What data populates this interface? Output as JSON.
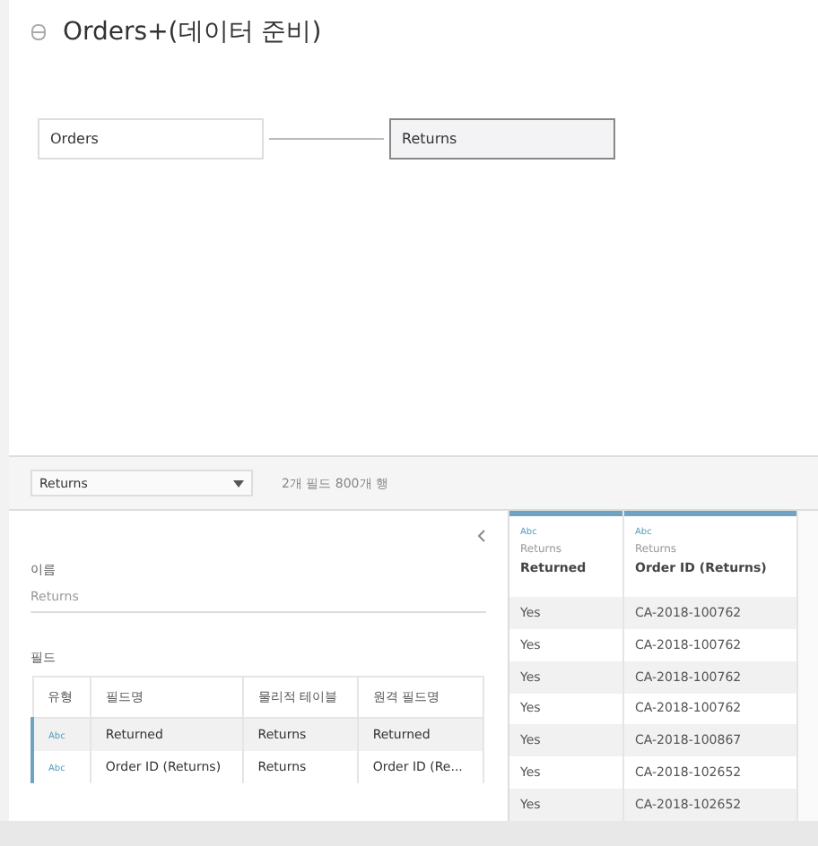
{
  "flow": {
    "title": "Orders+(데이터 준비)",
    "nodes": [
      {
        "label": "Orders",
        "selected": false
      },
      {
        "label": "Returns",
        "selected": true
      }
    ]
  },
  "toolbar": {
    "table_select": "Returns",
    "summary": "2개 필드 800개 행"
  },
  "details": {
    "name_label": "이름",
    "name_value": "Returns",
    "fields_label": "필드",
    "columns": [
      "유형",
      "필드명",
      "물리적 테이블",
      "원격 필드명"
    ],
    "rows": [
      {
        "type": "Abc",
        "field": "Returned",
        "table": "Returns",
        "remote": "Returned",
        "selected": true
      },
      {
        "type": "Abc",
        "field": "Order ID (Returns)",
        "table": "Returns",
        "remote": "Order ID (Re...",
        "selected": false
      }
    ]
  },
  "grid": {
    "columns": [
      {
        "type": "Abc",
        "source": "Returns",
        "name": "Returned"
      },
      {
        "type": "Abc",
        "source": "Returns",
        "name": "Order ID (Returns)"
      }
    ],
    "rows": [
      [
        "Yes",
        "CA-2018-100762"
      ],
      [
        "Yes",
        "CA-2018-100762"
      ],
      [
        "Yes",
        "CA-2018-100762"
      ],
      [
        "Yes",
        "CA-2018-100762"
      ],
      [
        "Yes",
        "CA-2018-100867"
      ],
      [
        "Yes",
        "CA-2018-102652"
      ],
      [
        "Yes",
        "CA-2018-102652"
      ]
    ]
  }
}
